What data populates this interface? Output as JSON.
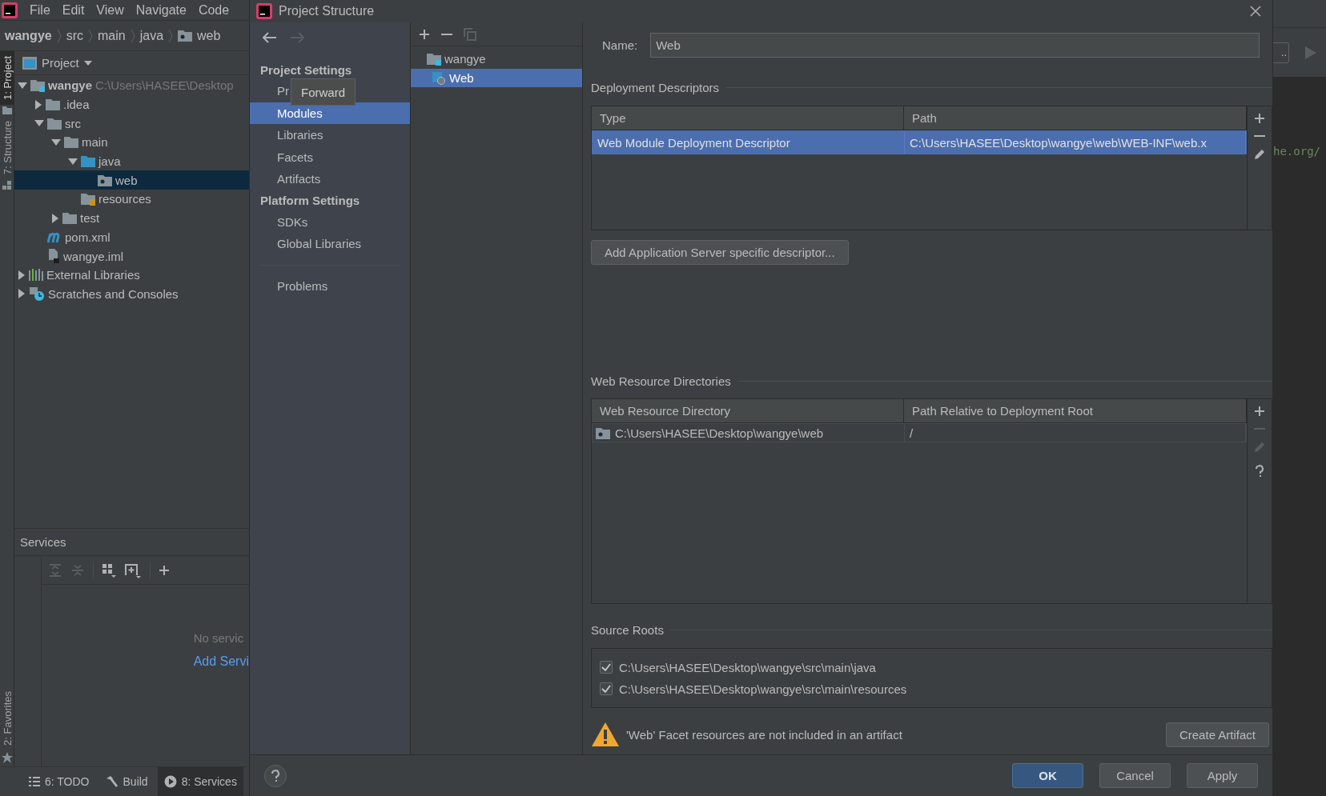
{
  "ide": {
    "menu": [
      "File",
      "Edit",
      "View",
      "Navigate",
      "Code"
    ],
    "breadcrumb": [
      {
        "label": "wangye",
        "kind": "project"
      },
      {
        "label": "src",
        "kind": "plain"
      },
      {
        "label": "main",
        "kind": "plain"
      },
      {
        "label": "java",
        "kind": "plain"
      },
      {
        "label": "web",
        "kind": "web-folder"
      }
    ],
    "side_tabs": [
      {
        "label": "1: Project",
        "kind": "project",
        "selected": true
      },
      {
        "label": "7: Structure",
        "kind": "structure",
        "selected": false
      }
    ],
    "favorites_tab": {
      "label": "2: Favorites",
      "selected": false
    },
    "project_view": {
      "title": "Project",
      "tree": [
        {
          "label": "wangye",
          "path": "C:\\Users\\HASEE\\Desktop",
          "kind": "module",
          "expanded": true,
          "selected": false,
          "children": [
            {
              "label": ".idea",
              "kind": "folder",
              "expanded": false,
              "selected": false
            },
            {
              "label": "src",
              "kind": "folder",
              "expanded": true,
              "selected": false,
              "children": [
                {
                  "label": "main",
                  "kind": "folder",
                  "expanded": true,
                  "selected": false,
                  "children": [
                    {
                      "label": "java",
                      "kind": "source-folder",
                      "expanded": true,
                      "selected": false,
                      "children": [
                        {
                          "label": "web",
                          "kind": "web-folder",
                          "selected": true
                        }
                      ]
                    },
                    {
                      "label": "resources",
                      "kind": "resources-folder",
                      "selected": false
                    }
                  ]
                },
                {
                  "label": "test",
                  "kind": "folder",
                  "expanded": false,
                  "selected": false
                }
              ]
            },
            {
              "label": "pom.xml",
              "kind": "maven",
              "selected": false
            },
            {
              "label": "wangye.iml",
              "kind": "file",
              "selected": false
            }
          ]
        },
        {
          "label": "External Libraries",
          "kind": "libraries",
          "expanded": false,
          "selected": false
        },
        {
          "label": "Scratches and Consoles",
          "kind": "scratches",
          "expanded": false,
          "selected": false
        }
      ]
    },
    "services": {
      "title": "Services",
      "tools": [
        {
          "kind": "expand",
          "disabled": true
        },
        {
          "kind": "collapse",
          "disabled": true
        },
        {
          "kind": "group",
          "disabled": false
        },
        {
          "kind": "new-group",
          "disabled": false
        },
        {
          "kind": "add",
          "disabled": false
        }
      ],
      "empty_text": "No servic",
      "add_link": "Add Servi"
    },
    "bottom_tabs": [
      {
        "label": "6: TODO",
        "kind": "todo",
        "selected": false
      },
      {
        "label": "Build",
        "kind": "build",
        "selected": false
      },
      {
        "label": "8: Services",
        "kind": "services",
        "selected": true
      }
    ],
    "editor": {
      "code_text": "he.org/",
      "button": ".."
    }
  },
  "dialog": {
    "title": "Project Structure",
    "nav_arrows": [
      {
        "kind": "back",
        "disabled": false
      },
      {
        "kind": "forward",
        "disabled": true
      }
    ],
    "tooltip": "Forward",
    "nav": [
      {
        "heading": "Project Settings",
        "items": [
          {
            "label": "Pr",
            "selected": false
          },
          {
            "label": "Modules",
            "selected": true
          },
          {
            "label": "Libraries",
            "selected": false
          },
          {
            "label": "Facets",
            "selected": false
          },
          {
            "label": "Artifacts",
            "selected": false
          }
        ]
      },
      {
        "heading": "Platform Settings",
        "items": [
          {
            "label": "SDKs",
            "selected": false
          },
          {
            "label": "Global Libraries",
            "selected": false
          }
        ]
      }
    ],
    "problems": {
      "label": "Problems",
      "selected": false
    },
    "list_tools": [
      {
        "kind": "add",
        "disabled": false
      },
      {
        "kind": "remove",
        "disabled": false
      },
      {
        "kind": "copy",
        "disabled": true
      }
    ],
    "modules": [
      {
        "label": "wangye",
        "kind": "module",
        "selected": false,
        "children": [
          {
            "label": "Web",
            "kind": "web-facet",
            "selected": true
          }
        ]
      }
    ],
    "name_field": {
      "label": "Name:",
      "value": "Web"
    },
    "deployment": {
      "title": "Deployment Descriptors",
      "columns": [
        "Type",
        "Path"
      ],
      "rows": [
        {
          "cells": [
            "Web Module Deployment Descriptor",
            "C:\\Users\\HASEE\\Desktop\\wangye\\web\\WEB-INF\\web.x"
          ],
          "selected": true
        }
      ],
      "tools": [
        {
          "kind": "add",
          "disabled": false
        },
        {
          "kind": "remove",
          "disabled": false
        },
        {
          "kind": "edit",
          "disabled": false
        }
      ]
    },
    "add_descriptor_button": "Add Application Server specific descriptor...",
    "web_resources": {
      "title": "Web Resource Directories",
      "columns": [
        "Web Resource Directory",
        "Path Relative to Deployment Root"
      ],
      "rows": [
        {
          "cells": [
            "C:\\Users\\HASEE\\Desktop\\wangye\\web",
            "/"
          ],
          "selected": false
        }
      ],
      "tools": [
        {
          "kind": "add",
          "disabled": false
        },
        {
          "kind": "remove",
          "disabled": true
        },
        {
          "kind": "edit",
          "disabled": true
        },
        {
          "kind": "help",
          "disabled": false
        }
      ]
    },
    "source_roots": {
      "title": "Source Roots",
      "items": [
        {
          "path": "C:\\Users\\HASEE\\Desktop\\wangye\\src\\main\\java",
          "checked": true
        },
        {
          "path": "C:\\Users\\HASEE\\Desktop\\wangye\\src\\main\\resources",
          "checked": true
        }
      ]
    },
    "warning": {
      "text": "'Web' Facet resources are not included in an artifact",
      "button": "Create Artifact"
    },
    "buttons": [
      {
        "label": "OK",
        "kind": "default"
      },
      {
        "label": "Cancel",
        "kind": "normal"
      },
      {
        "label": "Apply",
        "kind": "normal"
      }
    ]
  }
}
